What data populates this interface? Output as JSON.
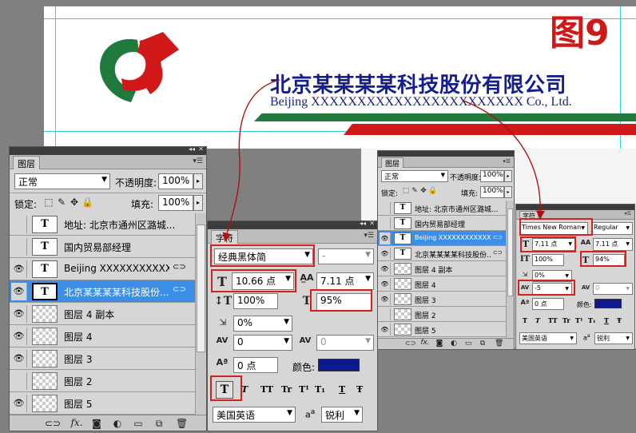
{
  "figure_label": "图9",
  "company": {
    "name_cn": "北京某某某某科技股份有限公司",
    "name_en": "Beijing XXXXXXXXXXXXXXXXXXXXXXX Co., Ltd."
  },
  "colors": {
    "brand_red": "#d01818",
    "brand_green": "#1f7a3c",
    "text_blue": "#141e8c",
    "color_swatch": "#0c1a8e",
    "selection": "#3d8ee6"
  },
  "layers_large": {
    "tab": "图层",
    "blend_mode": "正常",
    "opacity_label": "不透明度:",
    "opacity_value": "100%",
    "lock_label": "锁定:",
    "fill_label": "填充:",
    "fill_value": "100%",
    "layers": [
      {
        "name": "地址: 北京市通州区潞城...",
        "type": "text",
        "visible": false
      },
      {
        "name": "国内贸易部经理",
        "type": "text",
        "visible": false
      },
      {
        "name": "Beijing XXXXXXXXXXXXXX...",
        "type": "text",
        "visible": true
      },
      {
        "name": "北京某某某某科技股份...",
        "type": "text",
        "visible": true,
        "selected": true
      },
      {
        "name": "图层 4 副本",
        "type": "raster",
        "visible": true
      },
      {
        "name": "图层 4",
        "type": "raster",
        "visible": true
      },
      {
        "name": "图层 3",
        "type": "raster",
        "visible": true
      },
      {
        "name": "图层 2",
        "type": "raster",
        "visible": false
      },
      {
        "name": "图层 5",
        "type": "raster",
        "visible": true
      }
    ]
  },
  "char_large": {
    "tab": "字符",
    "font_family": "经典黑体简",
    "font_style": "-",
    "font_size": "10.66 点",
    "leading": "7.11 点",
    "vertical_scale": "100%",
    "horizontal_scale": "95%",
    "tsume": "0%",
    "kerning": "0",
    "tracking": "0",
    "baseline_shift": "0 点",
    "color_label": "颜色:",
    "language": "美国英语",
    "aa_label": "a",
    "antialias": "锐利",
    "format_buttons": [
      "T",
      "T",
      "TT",
      "Tr",
      "T¹",
      "T₁",
      "T",
      "Ŧ"
    ]
  },
  "layers_small": {
    "tab": "图层",
    "blend_mode": "正常",
    "opacity_label": "不透明度:",
    "opacity_value": "100%",
    "lock_label": "锁定:",
    "fill_label": "填充:",
    "fill_value": "100%",
    "layers": [
      {
        "name": "地址: 北京市通州区潞城...",
        "type": "text",
        "visible": false
      },
      {
        "name": "国内贸易部经理",
        "type": "text",
        "visible": false
      },
      {
        "name": "Beijing XXXXXXXXXXXXX...",
        "type": "text",
        "visible": true,
        "selected": true
      },
      {
        "name": "北京某某某某科技股份...",
        "type": "text",
        "visible": true
      },
      {
        "name": "图层 4 副本",
        "type": "raster",
        "visible": true
      },
      {
        "name": "图层 4",
        "type": "raster",
        "visible": true
      },
      {
        "name": "图层 3",
        "type": "raster",
        "visible": true
      },
      {
        "name": "图层 2",
        "type": "raster",
        "visible": false
      },
      {
        "name": "图层 5",
        "type": "raster",
        "visible": true
      }
    ]
  },
  "char_small": {
    "tab": "字符",
    "font_family": "Times New Roman",
    "font_style": "Regular",
    "font_size": "7.11 点",
    "leading": "7.11 点",
    "vertical_scale": "100%",
    "horizontal_scale": "94%",
    "tsume": "0%",
    "kerning": "-5",
    "tracking": "0",
    "baseline_shift": "0 点",
    "color_label": "颜色:",
    "language": "美国英语",
    "aa_label": "a",
    "antialias": "锐利",
    "format_buttons": [
      "T",
      "T",
      "TT",
      "Tr",
      "T¹",
      "T₁",
      "T",
      "Ŧ"
    ]
  }
}
